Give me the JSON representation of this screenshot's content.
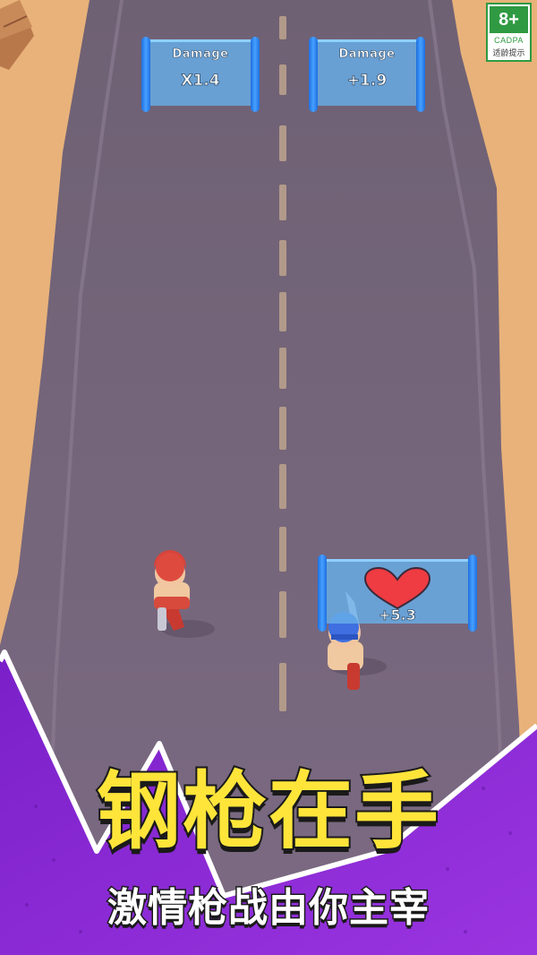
{
  "rating": {
    "age": "8+",
    "org": "CADPA",
    "hint": "适龄提示"
  },
  "gates": {
    "left": {
      "title": "Damage",
      "value": "X1.4"
    },
    "right": {
      "title": "Damage",
      "value": "+1.9"
    },
    "health": {
      "value": "+5.3",
      "icon": "heart-icon"
    }
  },
  "banner": {
    "title": "钢枪在手",
    "subtitle": "激情枪战由你主宰"
  },
  "colors": {
    "road": "#7a6a80",
    "sand": "#e9b47a",
    "gate": "#68aee8",
    "post": "#2a7ff0",
    "heart": "#ef3b42",
    "banner": "#8c2ad6",
    "headline": "#ffe53a"
  }
}
